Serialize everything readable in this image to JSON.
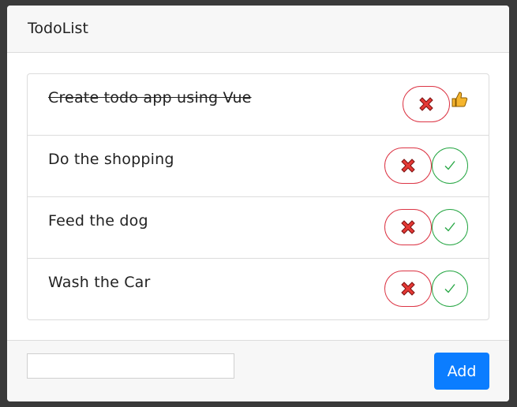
{
  "header": {
    "title": "TodoList"
  },
  "todos": [
    {
      "text": "Create todo app using Vue",
      "done": true,
      "done_icon": "thumbs-up-icon"
    },
    {
      "text": "Do the shopping",
      "done": false
    },
    {
      "text": "Feed the dog",
      "done": false
    },
    {
      "text": "Wash the Car",
      "done": false
    }
  ],
  "icons": {
    "delete": "cross-mark-icon",
    "complete": "check-mark-icon",
    "done": "thumbs-up-icon"
  },
  "footer": {
    "input_value": "",
    "input_placeholder": "",
    "add_label": "Add"
  },
  "colors": {
    "delete_border": "#dc3545",
    "delete_icon": "#e53935",
    "complete_border": "#28a745",
    "add_button": "#0b7dff",
    "thumb": "#f5b52e"
  }
}
